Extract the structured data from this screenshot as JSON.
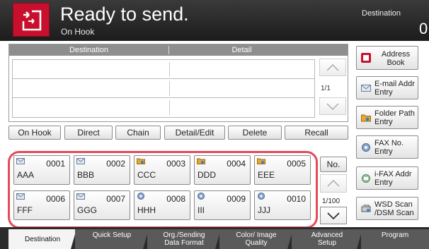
{
  "header": {
    "title": "Ready to send.",
    "subtitle": "On Hook",
    "destination_label": "Destination",
    "destination_count": "0"
  },
  "table": {
    "col_destination": "Destination",
    "col_detail": "Detail",
    "page_indicator": "1/1"
  },
  "side_buttons": {
    "address_book": "Address Book",
    "email": "E-mail Addr Entry",
    "folder": "Folder Path Entry",
    "fax": "FAX No. Entry",
    "ifax": "i-FAX Addr Entry",
    "wsd": "WSD Scan /DSM Scan"
  },
  "actions": {
    "on_hook": "On Hook",
    "direct": "Direct",
    "chain": "Chain",
    "detail_edit": "Detail/Edit",
    "delete": "Delete",
    "recall": "Recall"
  },
  "keys": [
    {
      "num": "0001",
      "name": "AAA",
      "icon": "email-icon"
    },
    {
      "num": "0002",
      "name": "BBB",
      "icon": "email-icon"
    },
    {
      "num": "0003",
      "name": "CCC",
      "icon": "folder-icon"
    },
    {
      "num": "0004",
      "name": "DDD",
      "icon": "folder-icon"
    },
    {
      "num": "0005",
      "name": "EEE",
      "icon": "folder-icon"
    },
    {
      "num": "0006",
      "name": "FFF",
      "icon": "email-icon"
    },
    {
      "num": "0007",
      "name": "GGG",
      "icon": "email-icon"
    },
    {
      "num": "0008",
      "name": "HHH",
      "icon": "fax-icon"
    },
    {
      "num": "0009",
      "name": "III",
      "icon": "fax-icon"
    },
    {
      "num": "0010",
      "name": "JJJ",
      "icon": "fax-icon"
    }
  ],
  "key_nav": {
    "no_label": "No.",
    "page_indicator": "1/100"
  },
  "tabs": [
    {
      "label": "Destination"
    },
    {
      "label": "Quick Setup"
    },
    {
      "label": "Org./Sending Data Format"
    },
    {
      "label": "Color/ Image Quality"
    },
    {
      "label": "Advanced Setup"
    },
    {
      "label": "Program"
    }
  ],
  "colors": {
    "brand_red": "#c8102e",
    "highlight_outline": "#e34a5a",
    "header_dark": "#1c1c1c"
  }
}
